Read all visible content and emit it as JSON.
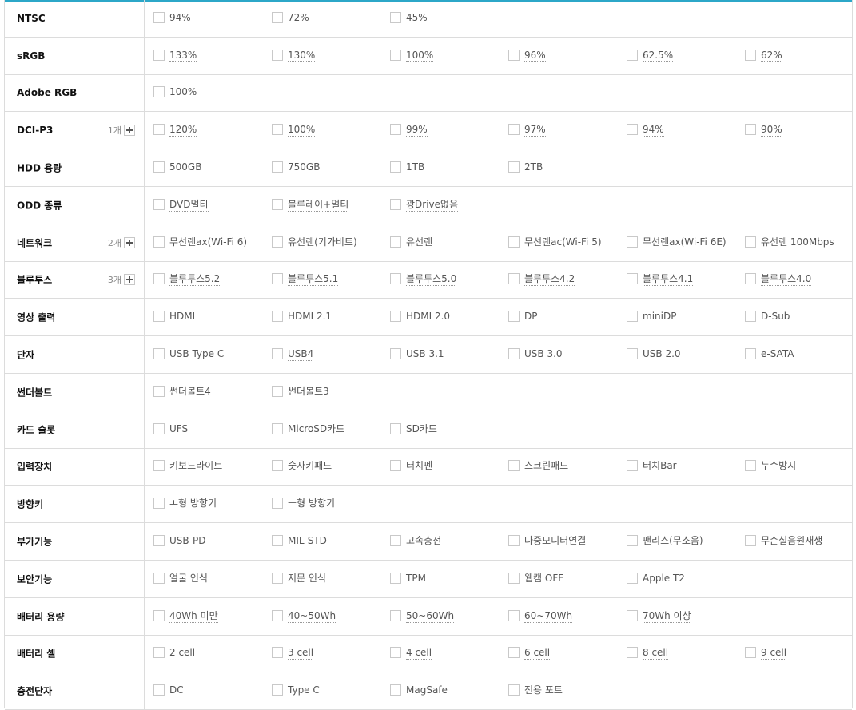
{
  "filters": [
    {
      "label": "NTSC",
      "options": [
        {
          "text": "94%"
        },
        {
          "text": "72%"
        },
        {
          "text": "45%"
        }
      ]
    },
    {
      "label": "sRGB",
      "options": [
        {
          "text": "133%",
          "dotted": true
        },
        {
          "text": "130%",
          "dotted": true
        },
        {
          "text": "100%",
          "dotted": true
        },
        {
          "text": "96%",
          "dotted": true
        },
        {
          "text": "62.5%",
          "dotted": true
        },
        {
          "text": "62%",
          "dotted": true
        }
      ]
    },
    {
      "label": "Adobe RGB",
      "options": [
        {
          "text": "100%"
        }
      ]
    },
    {
      "label": "DCI-P3",
      "count": "1개",
      "options": [
        {
          "text": "120%",
          "dotted": true
        },
        {
          "text": "100%",
          "dotted": true
        },
        {
          "text": "99%",
          "dotted": true
        },
        {
          "text": "97%",
          "dotted": true
        },
        {
          "text": "94%",
          "dotted": true
        },
        {
          "text": "90%",
          "dotted": true
        }
      ]
    },
    {
      "label": "HDD 용량",
      "options": [
        {
          "text": "500GB"
        },
        {
          "text": "750GB"
        },
        {
          "text": "1TB"
        },
        {
          "text": "2TB"
        }
      ]
    },
    {
      "label": "ODD 종류",
      "options": [
        {
          "text": "DVD멀티",
          "dotted": true
        },
        {
          "text": "블루레이+멀티",
          "dotted": true
        },
        {
          "text": "광Drive없음",
          "dotted": true
        }
      ]
    },
    {
      "label": "네트워크",
      "count": "2개",
      "options": [
        {
          "text": "무선랜ax(Wi-Fi 6)"
        },
        {
          "text": "유선랜(기가비트)"
        },
        {
          "text": "유선랜"
        },
        {
          "text": "무선랜ac(Wi-Fi 5)"
        },
        {
          "text": "무선랜ax(Wi-Fi 6E)"
        },
        {
          "text": "유선랜 100Mbps"
        }
      ]
    },
    {
      "label": "블루투스",
      "count": "3개",
      "options": [
        {
          "text": "블루투스5.2",
          "dotted": true
        },
        {
          "text": "블루투스5.1",
          "dotted": true
        },
        {
          "text": "블루투스5.0",
          "dotted": true
        },
        {
          "text": "블루투스4.2",
          "dotted": true
        },
        {
          "text": "블루투스4.1",
          "dotted": true
        },
        {
          "text": "블루투스4.0",
          "dotted": true
        }
      ]
    },
    {
      "label": "영상 출력",
      "options": [
        {
          "text": "HDMI",
          "dotted": true
        },
        {
          "text": "HDMI 2.1"
        },
        {
          "text": "HDMI 2.0",
          "dotted": true
        },
        {
          "text": "DP",
          "dotted": true
        },
        {
          "text": "miniDP"
        },
        {
          "text": "D-Sub"
        }
      ]
    },
    {
      "label": "단자",
      "options": [
        {
          "text": "USB Type C"
        },
        {
          "text": "USB4",
          "dotted": true
        },
        {
          "text": "USB 3.1"
        },
        {
          "text": "USB 3.0"
        },
        {
          "text": "USB 2.0"
        },
        {
          "text": "e-SATA"
        }
      ]
    },
    {
      "label": "썬더볼트",
      "options": [
        {
          "text": "썬더볼트4"
        },
        {
          "text": "썬더볼트3"
        }
      ]
    },
    {
      "label": "카드 슬롯",
      "options": [
        {
          "text": "UFS"
        },
        {
          "text": "MicroSD카드"
        },
        {
          "text": "SD카드"
        }
      ]
    },
    {
      "label": "입력장치",
      "options": [
        {
          "text": "키보드라이트"
        },
        {
          "text": "숫자키패드"
        },
        {
          "text": "터치펜"
        },
        {
          "text": "스크린패드"
        },
        {
          "text": "터치Bar"
        },
        {
          "text": "누수방지"
        }
      ]
    },
    {
      "label": "방향키",
      "options": [
        {
          "text": "ㅗ형 방향키"
        },
        {
          "text": "ㅡ형 방향키"
        }
      ]
    },
    {
      "label": "부가기능",
      "options": [
        {
          "text": "USB-PD"
        },
        {
          "text": "MIL-STD"
        },
        {
          "text": "고속충전"
        },
        {
          "text": "다중모니터연결"
        },
        {
          "text": "팬리스(무소음)"
        },
        {
          "text": "무손실음원재생"
        }
      ]
    },
    {
      "label": "보안기능",
      "options": [
        {
          "text": "얼굴 인식"
        },
        {
          "text": "지문 인식"
        },
        {
          "text": "TPM"
        },
        {
          "text": "웹캠 OFF"
        },
        {
          "text": "Apple T2"
        }
      ]
    },
    {
      "label": "배터리 용량",
      "options": [
        {
          "text": "40Wh 미만",
          "dotted": true
        },
        {
          "text": "40~50Wh",
          "dotted": true
        },
        {
          "text": "50~60Wh",
          "dotted": true
        },
        {
          "text": "60~70Wh",
          "dotted": true
        },
        {
          "text": "70Wh 이상",
          "dotted": true
        }
      ]
    },
    {
      "label": "배터리 셀",
      "options": [
        {
          "text": "2 cell"
        },
        {
          "text": "3 cell",
          "dotted": true
        },
        {
          "text": "4 cell",
          "dotted": true
        },
        {
          "text": "6 cell",
          "dotted": true
        },
        {
          "text": "8 cell",
          "dotted": true
        },
        {
          "text": "9 cell",
          "dotted": true
        }
      ]
    },
    {
      "label": "충전단자",
      "options": [
        {
          "text": "DC"
        },
        {
          "text": "Type C"
        },
        {
          "text": "MagSafe"
        },
        {
          "text": "전용 포트"
        }
      ]
    }
  ]
}
